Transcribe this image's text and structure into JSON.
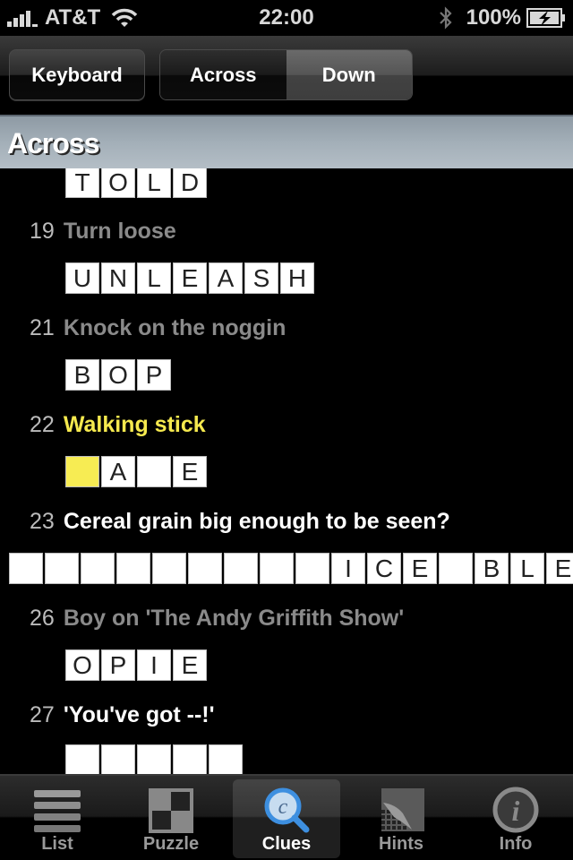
{
  "status_bar": {
    "carrier": "AT&T",
    "time": "22:00",
    "battery": "100%",
    "icons": [
      "signal-icon",
      "wifi-icon",
      "bluetooth-icon",
      "battery-charging-icon"
    ]
  },
  "toolbar": {
    "keyboard_label": "Keyboard",
    "segments": [
      {
        "label": "Across",
        "selected": true
      },
      {
        "label": "Down",
        "selected": false
      }
    ]
  },
  "section": {
    "title": "Across"
  },
  "clues": [
    {
      "number": "",
      "text": "",
      "state": "done",
      "cells": [
        "T",
        "O",
        "L",
        "D"
      ]
    },
    {
      "number": "19",
      "text": "Turn loose",
      "state": "done",
      "cells": [
        "U",
        "N",
        "L",
        "E",
        "A",
        "S",
        "H"
      ]
    },
    {
      "number": "21",
      "text": "Knock on the noggin",
      "state": "done",
      "cells": [
        "B",
        "O",
        "P"
      ]
    },
    {
      "number": "22",
      "text": "Walking stick",
      "state": "active",
      "cells": [
        "",
        "A",
        "",
        "E"
      ],
      "highlight_index": 0
    },
    {
      "number": "23",
      "text": "Cereal grain big enough to be seen?",
      "state": "open",
      "cells": [
        "",
        "",
        "",
        "",
        "",
        "",
        "",
        "",
        "",
        "I",
        "C",
        "E",
        "",
        "B",
        "L",
        "E"
      ]
    },
    {
      "number": "26",
      "text": "Boy on 'The Andy Griffith Show'",
      "state": "done",
      "cells": [
        "O",
        "P",
        "I",
        "E"
      ]
    },
    {
      "number": "27",
      "text": "'You've got --!'",
      "state": "open",
      "cells": [
        "",
        "",
        "",
        "",
        ""
      ]
    }
  ],
  "tabbar": {
    "tabs": [
      {
        "label": "List",
        "icon": "list-icon",
        "active": false
      },
      {
        "label": "Puzzle",
        "icon": "puzzle-grid-icon",
        "active": false
      },
      {
        "label": "Clues",
        "icon": "clues-magnifier-icon",
        "active": true
      },
      {
        "label": "Hints",
        "icon": "hints-page-curl-icon",
        "active": false
      },
      {
        "label": "Info",
        "icon": "info-icon",
        "active": false
      }
    ]
  },
  "colors": {
    "active_clue": "#f5e94e",
    "highlight_cell": "#f7ec53",
    "done_clue": "#8a8a8a",
    "section_header": "#a3afb8"
  }
}
